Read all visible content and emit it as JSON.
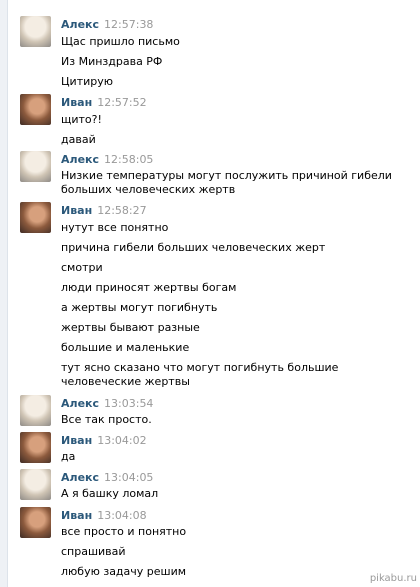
{
  "messages": [
    {
      "author": "Алекс",
      "time": "12:57:38",
      "avatar": "alex",
      "lines": [
        "Щас пришло письмо",
        "Из Минздрава РФ",
        "Цитирую"
      ]
    },
    {
      "author": "Иван",
      "time": "12:57:52",
      "avatar": "ivan",
      "lines": [
        "щито?!",
        "давай"
      ]
    },
    {
      "author": "Алекс",
      "time": "12:58:05",
      "avatar": "alex",
      "lines": [
        "Низкие температуры могут послужить причиной гибели больших человеческих жертв"
      ]
    },
    {
      "author": "Иван",
      "time": "12:58:27",
      "avatar": "ivan",
      "lines": [
        "нутут все понятно",
        "причина гибели больших человеческих жерт",
        "смотри",
        "люди приносят жертвы богам",
        "а жертвы могут погибнуть",
        "жертвы бывают разные",
        "большие и маленькие",
        "тут ясно сказано что могут погибнуть большие человеческие жертвы"
      ]
    },
    {
      "author": "Алекс",
      "time": "13:03:54",
      "avatar": "alex",
      "lines": [
        "Все так просто."
      ]
    },
    {
      "author": "Иван",
      "time": "13:04:02",
      "avatar": "ivan",
      "lines": [
        "да"
      ]
    },
    {
      "author": "Алекс",
      "time": "13:04:05",
      "avatar": "alex",
      "lines": [
        "А я башку ломал"
      ]
    },
    {
      "author": "Иван",
      "time": "13:04:08",
      "avatar": "ivan",
      "lines": [
        "все просто и понятно",
        "спрашивай",
        "любую задачу решим"
      ]
    }
  ],
  "watermark": "pikabu.ru"
}
